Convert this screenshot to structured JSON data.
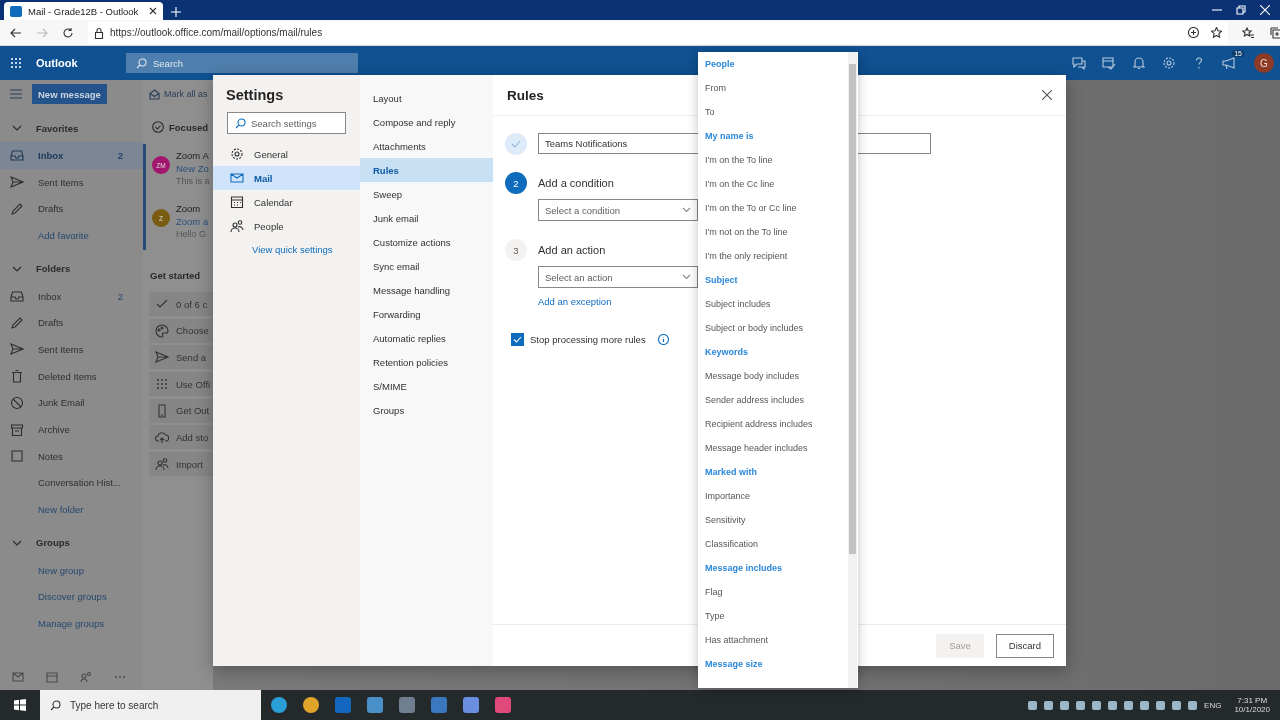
{
  "browser": {
    "tab_title": "Mail - Grade12B - Outlook",
    "url": "https://outlook.office.com/mail/options/mail/rules"
  },
  "header": {
    "app_name": "Outlook",
    "search_placeholder": "Search",
    "notification_count": "15",
    "avatar_initial": "G"
  },
  "left_nav": {
    "new_message": "New message",
    "sections": [
      {
        "title": "Favorites",
        "expanded": true,
        "items": [
          {
            "label": "Inbox",
            "kind": "inbox",
            "count": "2",
            "selected": true
          },
          {
            "label": "Sent Items",
            "kind": "sent",
            "selected": false
          },
          {
            "label": "Drafts",
            "kind": "drafts",
            "selected": false
          },
          {
            "label": "Add favorite",
            "kind": "link",
            "selected": false
          }
        ]
      },
      {
        "title": "Folders",
        "expanded": true,
        "items": [
          {
            "label": "Inbox",
            "kind": "inbox",
            "count": "2",
            "selected": false
          },
          {
            "label": "Drafts",
            "kind": "drafts",
            "selected": false
          },
          {
            "label": "Sent Items",
            "kind": "sent",
            "selected": false
          },
          {
            "label": "Deleted Items",
            "kind": "trash",
            "selected": false
          },
          {
            "label": "Junk Email",
            "kind": "junk",
            "selected": false
          },
          {
            "label": "Archive",
            "kind": "archive",
            "selected": false
          },
          {
            "label": "Notes",
            "kind": "notes",
            "selected": false
          },
          {
            "label": "Conversation Hist...",
            "kind": "plain",
            "selected": false
          },
          {
            "label": "New folder",
            "kind": "link",
            "selected": false
          }
        ]
      },
      {
        "title": "Groups",
        "expanded": true,
        "items": [
          {
            "label": "New group",
            "kind": "link",
            "selected": false
          },
          {
            "label": "Discover groups",
            "kind": "link",
            "selected": false
          },
          {
            "label": "Manage groups",
            "kind": "link",
            "selected": false
          }
        ]
      }
    ]
  },
  "message_list": {
    "toolbar_action": "Mark all as",
    "tab": "Focused",
    "messages": [
      {
        "initials": "ZM",
        "color": "#a3166f",
        "sender": "Zoom A",
        "subject": "New Zo",
        "preview": "This is a"
      },
      {
        "initials": "Z",
        "color": "#7a5b12",
        "sender": "Zoom",
        "subject": "Zoom a",
        "preview": "Hello G"
      }
    ],
    "get_started": {
      "title": "Get started",
      "items": [
        {
          "kind": "check",
          "text": "0 of 6 c"
        },
        {
          "kind": "palette",
          "text": "Choose"
        },
        {
          "kind": "send",
          "text": "Send a"
        },
        {
          "kind": "apps",
          "text": "Use Offi"
        },
        {
          "kind": "phone",
          "text": "Get Out"
        },
        {
          "kind": "cloud",
          "text": "Add sto"
        },
        {
          "kind": "people",
          "text": "Import"
        }
      ]
    }
  },
  "settings": {
    "title": "Settings",
    "search_placeholder": "Search settings",
    "categories": [
      {
        "label": "General",
        "kind": "gear",
        "selected": false
      },
      {
        "label": "Mail",
        "kind": "mail",
        "selected": true
      },
      {
        "label": "Calendar",
        "kind": "calendar",
        "selected": false
      },
      {
        "label": "People",
        "kind": "people",
        "selected": false
      }
    ],
    "quick_settings_link": "View quick settings",
    "subcategories": [
      {
        "label": "Layout",
        "selected": false
      },
      {
        "label": "Compose and reply",
        "selected": false
      },
      {
        "label": "Attachments",
        "selected": false
      },
      {
        "label": "Rules",
        "selected": true
      },
      {
        "label": "Sweep",
        "selected": false
      },
      {
        "label": "Junk email",
        "selected": false
      },
      {
        "label": "Customize actions",
        "selected": false
      },
      {
        "label": "Sync email",
        "selected": false
      },
      {
        "label": "Message handling",
        "selected": false
      },
      {
        "label": "Forwarding",
        "selected": false
      },
      {
        "label": "Automatic replies",
        "selected": false
      },
      {
        "label": "Retention policies",
        "selected": false
      },
      {
        "label": "S/MIME",
        "selected": false
      },
      {
        "label": "Groups",
        "selected": false
      }
    ],
    "rule_editor": {
      "title": "Rules",
      "steps": [
        {
          "kind": "done",
          "value": "Teams Notifications"
        },
        {
          "kind": "active",
          "number": "2",
          "label": "Add a condition",
          "placeholder": "Select a condition"
        },
        {
          "kind": "pending",
          "number": "3",
          "label": "Add an action",
          "placeholder": "Select an action",
          "link": "Add an exception"
        }
      ],
      "stop_processing": {
        "label": "Stop processing more rules",
        "checked": true
      },
      "buttons": [
        {
          "label": "Save",
          "disabled": true
        },
        {
          "label": "Discard",
          "disabled": false
        }
      ]
    }
  },
  "condition_menu": {
    "items": [
      {
        "label": "People",
        "kind": "header"
      },
      {
        "label": "From",
        "kind": "option"
      },
      {
        "label": "To",
        "kind": "option"
      },
      {
        "label": "My name is",
        "kind": "header"
      },
      {
        "label": "I'm on the To line",
        "kind": "option"
      },
      {
        "label": "I'm on the Cc line",
        "kind": "option"
      },
      {
        "label": "I'm on the To or Cc line",
        "kind": "option"
      },
      {
        "label": "I'm not on the To line",
        "kind": "option"
      },
      {
        "label": "I'm the only recipient",
        "kind": "option"
      },
      {
        "label": "Subject",
        "kind": "header"
      },
      {
        "label": "Subject includes",
        "kind": "option"
      },
      {
        "label": "Subject or body includes",
        "kind": "option"
      },
      {
        "label": "Keywords",
        "kind": "header"
      },
      {
        "label": "Message body includes",
        "kind": "option"
      },
      {
        "label": "Sender address includes",
        "kind": "option"
      },
      {
        "label": "Recipient address includes",
        "kind": "option"
      },
      {
        "label": "Message header includes",
        "kind": "option"
      },
      {
        "label": "Marked with",
        "kind": "header"
      },
      {
        "label": "Importance",
        "kind": "option"
      },
      {
        "label": "Sensitivity",
        "kind": "option"
      },
      {
        "label": "Classification",
        "kind": "option"
      },
      {
        "label": "Message includes",
        "kind": "header"
      },
      {
        "label": "Flag",
        "kind": "option"
      },
      {
        "label": "Type",
        "kind": "option"
      },
      {
        "label": "Has attachment",
        "kind": "option"
      },
      {
        "label": "Message size",
        "kind": "header"
      }
    ]
  },
  "taskbar": {
    "search_placeholder": "Type here to search",
    "language": "ENG",
    "time": "7:31 PM",
    "date": "10/1/2020"
  }
}
